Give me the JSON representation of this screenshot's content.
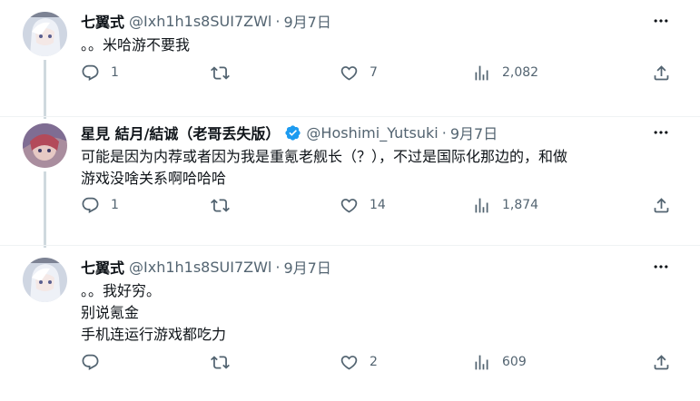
{
  "tweets": [
    {
      "name": "七翼式",
      "handle": "@Ixh1h1s8SUI7ZWl",
      "separator": "·",
      "date": "9月7日",
      "lines": [
        "。。米哈游不要我"
      ],
      "replies": "1",
      "retweets": "",
      "likes": "7",
      "views": "2,082"
    },
    {
      "name": "星見 結月/結诚（老哥丢失版）",
      "verified": true,
      "handle": "@Hoshimi_Yutsuki",
      "separator": "·",
      "date": "9月7日",
      "lines": [
        "可能是因为内荐或者因为我是重氪老舰长（？），不过是国际化那边的，和做",
        "游戏没啥关系啊哈哈哈"
      ],
      "replies": "1",
      "retweets": "",
      "likes": "14",
      "views": "1,874"
    },
    {
      "name": "七翼式",
      "handle": "@Ixh1h1s8SUI7ZWl",
      "separator": "·",
      "date": "9月7日",
      "lines": [
        "。。我好穷。",
        "别说氪金",
        "手机连运行游戏都吃力"
      ],
      "replies": "",
      "retweets": "",
      "likes": "2",
      "views": "609"
    }
  ],
  "colors": {
    "text": "#0f1419",
    "secondary": "#536471",
    "verified": "#1d9bf0",
    "thread_line": "#cfd9de"
  },
  "icons": {
    "reply": "reply-icon",
    "retweet": "retweet-icon",
    "like": "heart-icon",
    "views": "views-icon",
    "share": "share-icon",
    "more": "more-dots-icon",
    "verified": "verified-badge-icon"
  }
}
